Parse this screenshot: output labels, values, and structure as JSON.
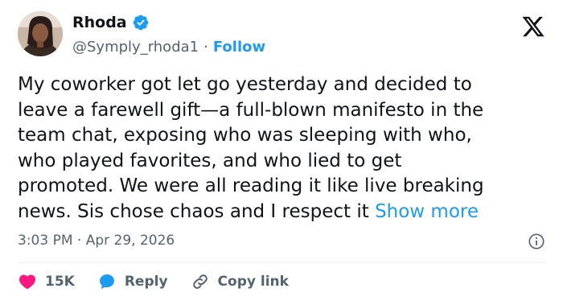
{
  "author": {
    "display_name": "Rhoda",
    "handle": "@Symply_rhoda1",
    "separator": "·",
    "follow_label": "Follow"
  },
  "tweet": {
    "lines": [
      "My coworker got let go yesterday and decided to",
      "leave a farewell gift—a full-blown manifesto in the",
      "team chat, exposing who was sleeping with who,",
      "who played favorites, and who lied to get",
      "promoted. We were all reading it like live breaking",
      "news. Sis chose chaos and I respect it "
    ],
    "show_more_label": "Show more"
  },
  "meta": {
    "time": "3:03 PM",
    "separator": "·",
    "date": "Apr 29, 2026"
  },
  "actions": {
    "like_count": "15K",
    "reply_label": "Reply",
    "copy_link_label": "Copy link"
  },
  "colors": {
    "accent": "#1d9bf0",
    "like": "#f91880",
    "muted": "#536471",
    "text": "#0f1419"
  },
  "icons": [
    "verified-badge-icon",
    "x-logo-icon",
    "info-icon",
    "heart-icon",
    "reply-bubble-icon",
    "link-icon"
  ]
}
